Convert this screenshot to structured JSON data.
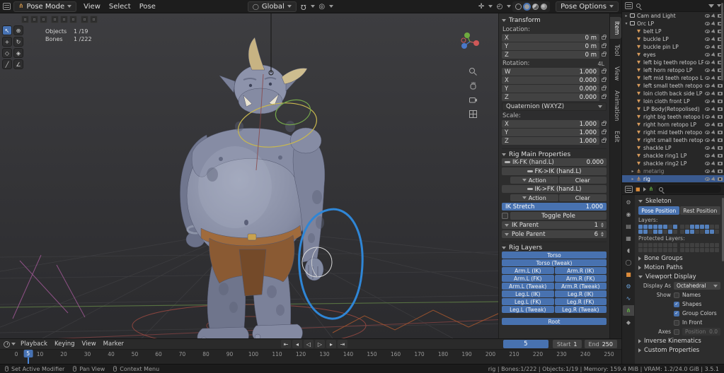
{
  "topbar": {
    "mode": "Pose Mode",
    "menus": [
      "View",
      "Select",
      "Pose"
    ],
    "orientation": "Global",
    "pose_options": "Pose Options",
    "shading_modes": [
      "wireframe",
      "solid",
      "material-preview",
      "rendered"
    ]
  },
  "toolbar": {
    "tools": [
      {
        "name": "select-box",
        "glyph": "↖",
        "active": true
      },
      {
        "name": "cursor",
        "glyph": "⊕",
        "active": false
      },
      {
        "name": "move",
        "glyph": "+",
        "active": false
      },
      {
        "name": "rotate",
        "glyph": "↻",
        "active": false
      },
      {
        "name": "scale",
        "glyph": "◇",
        "active": false
      },
      {
        "name": "transform",
        "glyph": "◈",
        "active": false
      },
      {
        "name": "annotate",
        "glyph": "╱",
        "active": false
      },
      {
        "name": "measure",
        "glyph": "∠",
        "active": false
      }
    ]
  },
  "viewport": {
    "stats": [
      {
        "label": "Objects",
        "value": "1 /19"
      },
      {
        "label": "Bones",
        "value": "1 /222"
      }
    ]
  },
  "sidebar": {
    "tabs": [
      {
        "label": "Item",
        "active": true
      },
      {
        "label": "Tool",
        "active": false
      },
      {
        "label": "View",
        "active": false
      },
      {
        "label": "Animation",
        "active": false
      },
      {
        "label": "Edit",
        "active": false
      }
    ],
    "transform": {
      "title": "Transform",
      "location_label": "Location:",
      "location": [
        {
          "axis": "X",
          "value": "0 m"
        },
        {
          "axis": "Y",
          "value": "0 m"
        },
        {
          "axis": "Z",
          "value": "0 m"
        }
      ],
      "rotation_label": "Rotation:",
      "rotation_badge": "4L",
      "rotation": [
        {
          "axis": "W",
          "value": "1.000"
        },
        {
          "axis": "X",
          "value": "0.000"
        },
        {
          "axis": "Y",
          "value": "0.000"
        },
        {
          "axis": "Z",
          "value": "0.000"
        }
      ],
      "rotation_mode": "Quaternion (WXYZ)",
      "scale_label": "Scale:",
      "scale": [
        {
          "axis": "X",
          "value": "1.000"
        },
        {
          "axis": "Y",
          "value": "1.000"
        },
        {
          "axis": "Z",
          "value": "1.000"
        }
      ]
    },
    "rig_main": {
      "title": "Rig Main Properties",
      "ikfk": {
        "label": "IK-FK (hand.L)",
        "value": "0.000"
      },
      "snap_buttons": [
        "FK->IK (hand.L)",
        "IK->FK (hand.L)"
      ],
      "action_label": "Action",
      "clear_label": "Clear",
      "ik_stretch": {
        "label": "IK Stretch",
        "value": "1.000"
      },
      "toggle_pole": "Toggle Pole",
      "ik_parent": {
        "label": "IK Parent",
        "value": "1"
      },
      "pole_parent": {
        "label": "Pole Parent",
        "value": "6"
      }
    },
    "rig_layers": {
      "title": "Rig Layers",
      "wide_top": [
        "Torso",
        "Torso (Tweak)"
      ],
      "pairs": [
        [
          "Arm.L (IK)",
          "Arm.R (IK)"
        ],
        [
          "Arm.L (FK)",
          "Arm.R (FK)"
        ],
        [
          "Arm.L (Tweak)",
          "Arm.R (Tweak)"
        ],
        [
          "Leg.L (IK)",
          "Leg.R (IK)"
        ],
        [
          "Leg.L (FK)",
          "Leg.R (FK)"
        ],
        [
          "Leg.L (Tweak)",
          "Leg.R (Tweak)"
        ]
      ],
      "wide_bottom": [
        "Root"
      ]
    }
  },
  "outliner": {
    "items": [
      {
        "label": "Cam and Light",
        "type": "collection",
        "depth": 0,
        "arrow": "▸",
        "dim": false,
        "selected": false
      },
      {
        "label": "Orc LP",
        "type": "collection",
        "depth": 0,
        "arrow": "▾",
        "dim": false,
        "selected": false
      },
      {
        "label": "belt LP",
        "type": "mesh",
        "depth": 1,
        "arrow": "",
        "dim": false,
        "selected": false
      },
      {
        "label": "buckle LP",
        "type": "mesh",
        "depth": 1,
        "arrow": "",
        "dim": false,
        "selected": false
      },
      {
        "label": "buckle pin LP",
        "type": "mesh",
        "depth": 1,
        "arrow": "",
        "dim": false,
        "selected": false
      },
      {
        "label": "eyes",
        "type": "mesh",
        "depth": 1,
        "arrow": "",
        "dim": false,
        "selected": false
      },
      {
        "label": "left big teeth retopo LP",
        "type": "mesh",
        "depth": 1,
        "arrow": "",
        "dim": false,
        "selected": false
      },
      {
        "label": "left horn retopo LP",
        "type": "mesh",
        "depth": 1,
        "arrow": "",
        "dim": false,
        "selected": false
      },
      {
        "label": "left mid teeth retopo LP",
        "type": "mesh",
        "depth": 1,
        "arrow": "",
        "dim": false,
        "selected": false
      },
      {
        "label": "left small teeth retopo LP",
        "type": "mesh",
        "depth": 1,
        "arrow": "",
        "dim": false,
        "selected": false
      },
      {
        "label": "loin cloth back side LP",
        "type": "mesh",
        "depth": 1,
        "arrow": "",
        "dim": false,
        "selected": false
      },
      {
        "label": "loin cloth front LP",
        "type": "mesh",
        "depth": 1,
        "arrow": "",
        "dim": false,
        "selected": false
      },
      {
        "label": "LP Body(Retopolised)",
        "type": "mesh",
        "depth": 1,
        "arrow": "",
        "dim": false,
        "selected": false
      },
      {
        "label": "right big teeth retopo LP",
        "type": "mesh",
        "depth": 1,
        "arrow": "",
        "dim": false,
        "selected": false
      },
      {
        "label": "right horn retopo LP",
        "type": "mesh",
        "depth": 1,
        "arrow": "",
        "dim": false,
        "selected": false
      },
      {
        "label": "right mid teeth retopo LP",
        "type": "mesh",
        "depth": 1,
        "arrow": "",
        "dim": false,
        "selected": false
      },
      {
        "label": "right small teeth retopo LP",
        "type": "mesh",
        "depth": 1,
        "arrow": "",
        "dim": false,
        "selected": false
      },
      {
        "label": "shackle LP",
        "type": "mesh",
        "depth": 1,
        "arrow": "",
        "dim": false,
        "selected": false
      },
      {
        "label": "shackle ring1 LP",
        "type": "mesh",
        "depth": 1,
        "arrow": "",
        "dim": false,
        "selected": false
      },
      {
        "label": "shackle ring2 LP",
        "type": "mesh",
        "depth": 1,
        "arrow": "",
        "dim": false,
        "selected": false
      },
      {
        "label": "metarig",
        "type": "armature",
        "depth": 1,
        "arrow": "▸",
        "dim": true,
        "selected": false
      },
      {
        "label": "rig",
        "type": "armature",
        "depth": 1,
        "arrow": "▸",
        "dim": false,
        "selected": true
      }
    ]
  },
  "properties": {
    "tabs": [
      {
        "name": "tool",
        "glyph": "⚙",
        "color": "#9a9a9a",
        "active": false
      },
      {
        "name": "render",
        "glyph": "◉",
        "color": "#9a9a9a",
        "active": false
      },
      {
        "name": "output",
        "glyph": "▤",
        "color": "#9a9a9a",
        "active": false
      },
      {
        "name": "view-layer",
        "glyph": "▦",
        "color": "#9a9a9a",
        "active": false
      },
      {
        "name": "scene",
        "glyph": "◖",
        "color": "#9a9a9a",
        "active": false
      },
      {
        "name": "world",
        "glyph": "◯",
        "color": "#9a9a9a",
        "active": false
      },
      {
        "name": "object",
        "glyph": "■",
        "color": "#db8b3a",
        "active": false
      },
      {
        "name": "modifiers",
        "glyph": "⚙",
        "color": "#6ba1d8",
        "active": false
      },
      {
        "name": "physics",
        "glyph": "∿",
        "color": "#6ba1d8",
        "active": false
      },
      {
        "name": "object-data",
        "glyph": "⋔",
        "color": "#6cc24a",
        "active": true
      },
      {
        "name": "bone",
        "glyph": "◆",
        "color": "#9a9a9a",
        "active": false
      }
    ],
    "skeleton": {
      "title": "Skeleton",
      "pose_position": "Pose Position",
      "rest_position": "Rest Position",
      "layers_label": "Layers:",
      "layers_a": [
        [
          1,
          1,
          1,
          1,
          1,
          1,
          0,
          1
        ],
        [
          1,
          1,
          0,
          1,
          1,
          0,
          1,
          0
        ]
      ],
      "layers_b": [
        [
          0,
          0,
          1,
          1,
          1,
          1,
          0,
          0
        ],
        [
          0,
          1,
          1,
          0,
          0,
          1,
          1,
          0
        ]
      ],
      "protected_label": "Protected Layers:",
      "protected_a": [
        [
          0,
          0,
          0,
          0,
          0,
          0,
          0,
          0
        ],
        [
          0,
          0,
          0,
          0,
          0,
          0,
          0,
          0
        ]
      ],
      "protected_b": [
        [
          0,
          0,
          0,
          0,
          0,
          0,
          0,
          0
        ],
        [
          0,
          0,
          0,
          0,
          0,
          0,
          0,
          0
        ]
      ]
    },
    "sections_mid": [
      "Bone Groups",
      "Motion Paths"
    ],
    "viewport_display": {
      "title": "Viewport Display",
      "display_as_label": "Display As",
      "display_as_value": "Octahedral",
      "show_label": "Show",
      "checks": [
        {
          "label": "Names",
          "checked": false
        },
        {
          "label": "Shapes",
          "checked": true
        },
        {
          "label": "Group Colors",
          "checked": true
        },
        {
          "label": "In Front",
          "checked": false
        }
      ],
      "axes_label": "Axes",
      "axes_checked": false,
      "position_label": "Position",
      "position_value": "0.0"
    },
    "sections_bottom": [
      "Inverse Kinematics",
      "Custom Properties"
    ]
  },
  "timeline": {
    "menus": [
      "Playback",
      "Keying",
      "View",
      "Marker"
    ],
    "transport": [
      {
        "name": "jump-to-start",
        "glyph": "⇤"
      },
      {
        "name": "prev-keyframe",
        "glyph": "◂"
      },
      {
        "name": "play-reverse",
        "glyph": "◁"
      },
      {
        "name": "play",
        "glyph": "▷"
      },
      {
        "name": "next-keyframe",
        "glyph": "▸"
      },
      {
        "name": "jump-to-end",
        "glyph": "⇥"
      }
    ],
    "frame_field": "5",
    "start_label": "Start",
    "start_value": "1",
    "end_label": "End",
    "end_value": "250",
    "current_frame": 5,
    "ticks": [
      0,
      10,
      20,
      30,
      40,
      50,
      60,
      70,
      80,
      90,
      100,
      110,
      120,
      130,
      140,
      150,
      160,
      170,
      180,
      190,
      200,
      210,
      220,
      230,
      240,
      250
    ]
  },
  "statusbar": {
    "hints": [
      "Set Active Modifier",
      "Pan View",
      "Context Menu"
    ],
    "info": "rig | Bones:1/222 | Objects:1/19 | Memory: 159.4 MiB | VRAM: 1.2/24.0 GiB | 3.5.1"
  }
}
